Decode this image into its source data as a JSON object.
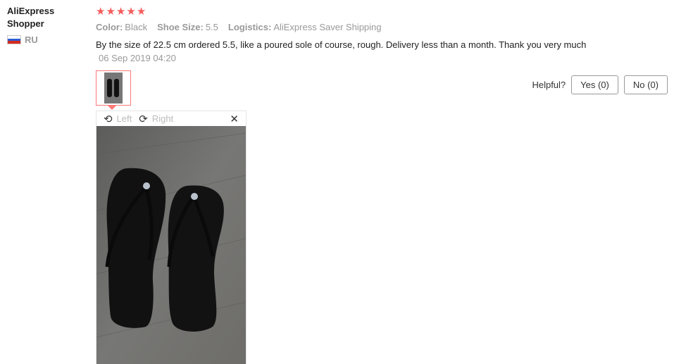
{
  "user": {
    "name": "AliExpress Shopper",
    "country": "RU",
    "flag_colors": [
      "#ffffff",
      "#2f5bd3",
      "#d52b1e"
    ]
  },
  "review": {
    "rating": 5,
    "star_color": "#f45c5c",
    "attributes": [
      {
        "label": "Color:",
        "value": "Black"
      },
      {
        "label": "Shoe Size:",
        "value": "5.5"
      },
      {
        "label": "Logistics:",
        "value": "AliExpress Saver Shipping"
      }
    ],
    "text": "By the size of 22.5 cm ordered 5.5, like a poured sole of course, rough. Delivery less than a month. Thank you very much",
    "date": "06 Sep 2019 04:20"
  },
  "helpful": {
    "label": "Helpful?",
    "yes": "Yes (0)",
    "no": "No (0)"
  },
  "viewer": {
    "rotate_left": "Left",
    "rotate_right": "Right",
    "rotate_left_icon": "rotate-left-icon",
    "rotate_right_icon": "rotate-right-icon",
    "close_icon": "close-icon"
  }
}
